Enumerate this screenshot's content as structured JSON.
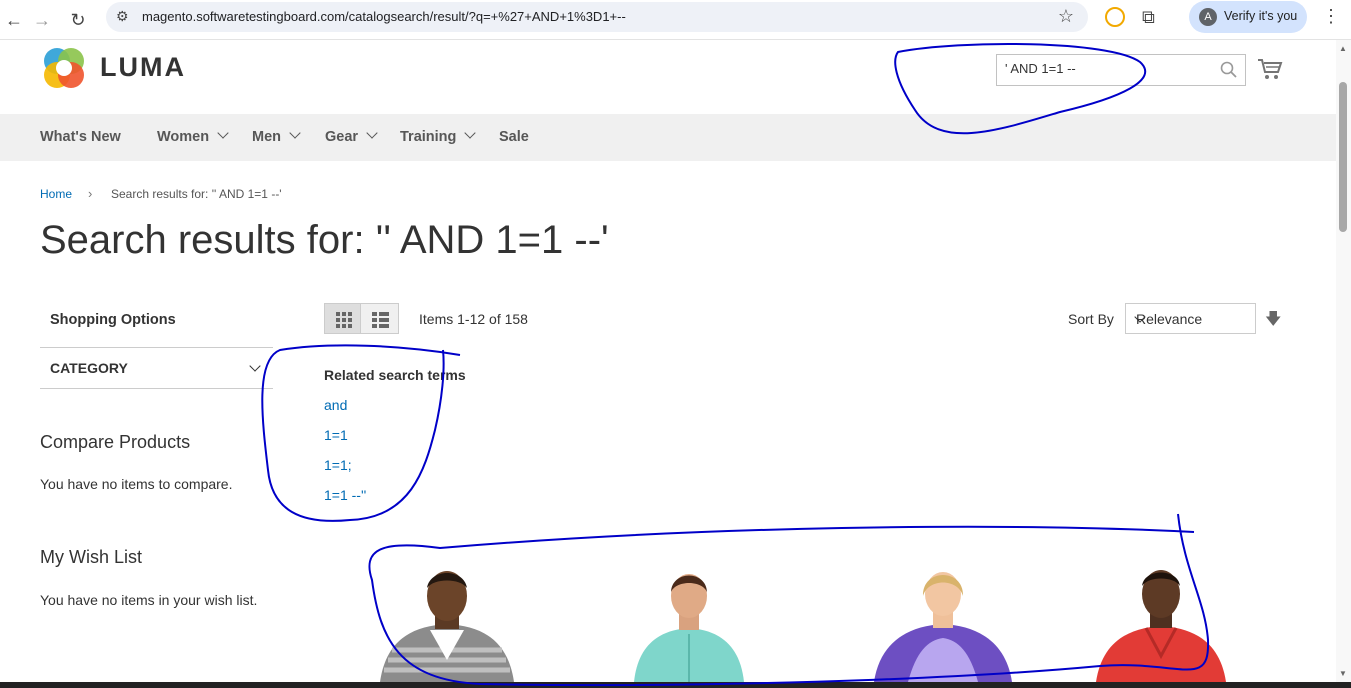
{
  "browser": {
    "url": "magento.softwaretestingboard.com/catalogsearch/result/?q=+%27+AND+1%3D1+--",
    "profile_initial": "A",
    "profile_label": "Verify it's you"
  },
  "header": {
    "logo_text": "LUMA",
    "search_value": "' AND 1=1 --"
  },
  "nav": {
    "items": [
      {
        "label": "What's New"
      },
      {
        "label": "Women"
      },
      {
        "label": "Men"
      },
      {
        "label": "Gear"
      },
      {
        "label": "Training"
      },
      {
        "label": "Sale"
      }
    ]
  },
  "breadcrumb": {
    "home": "Home",
    "separator": "›",
    "current": "Search results for: '' AND 1=1 --'"
  },
  "page_title": "Search results for: '' AND 1=1 --'",
  "sidebar": {
    "shopping_options": "Shopping Options",
    "category": "CATEGORY",
    "compare_title": "Compare Products",
    "compare_text": "You have no items to compare.",
    "wishlist_title": "My Wish List",
    "wishlist_text": "You have no items in your wish list."
  },
  "toolbar": {
    "amount": "Items 1-12 of 158",
    "sort_label": "Sort By",
    "sort_value": "Relevance"
  },
  "related": {
    "title": "Related search terms",
    "links": [
      "and",
      "1=1",
      "1=1;",
      "1=1 --''"
    ]
  },
  "colors": {
    "link": "#006bb4",
    "nav_bg": "#f0f0f0",
    "annotation": "#0000c8"
  }
}
